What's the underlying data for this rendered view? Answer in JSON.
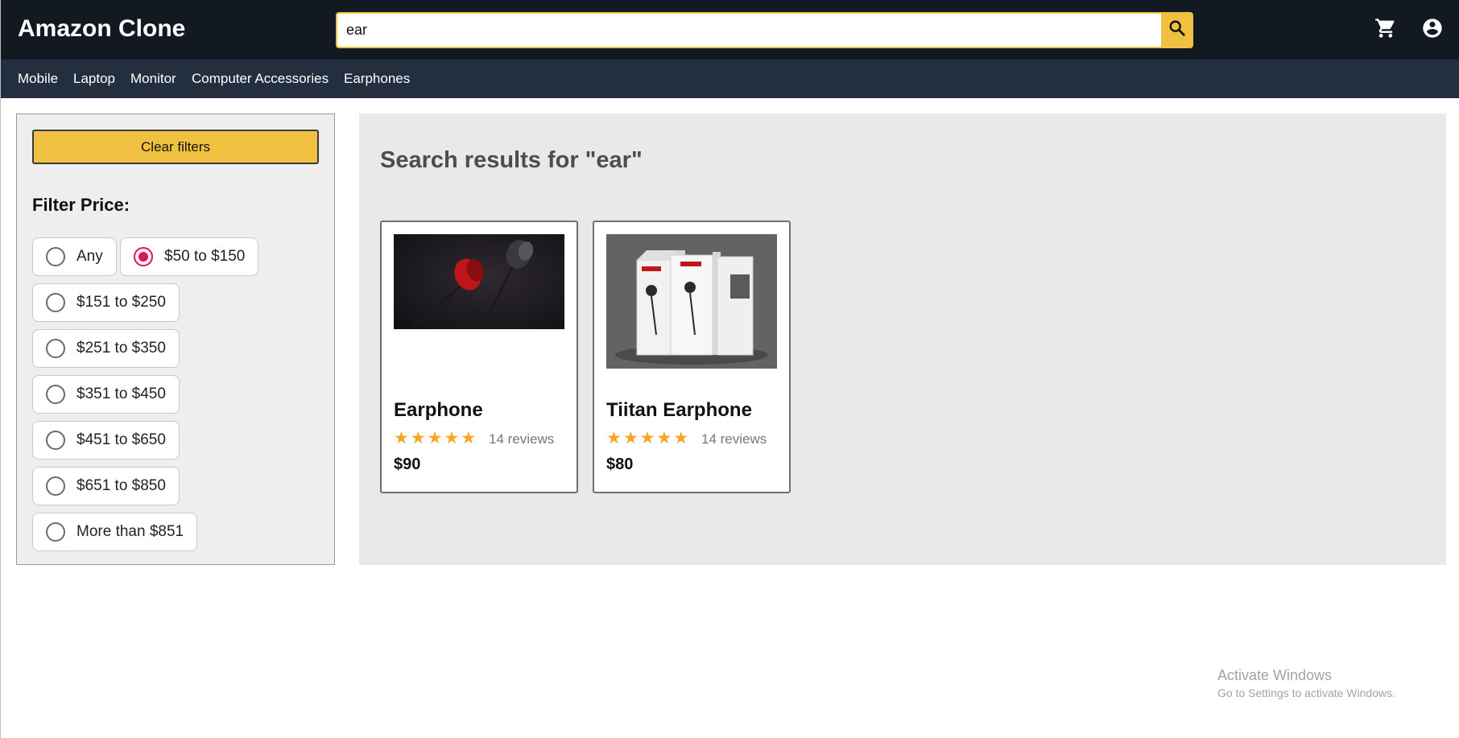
{
  "header": {
    "brand": "Amazon Clone",
    "search_value": "ear",
    "search_placeholder": "",
    "search_icon": "search-icon",
    "cart_icon": "cart-icon",
    "account_icon": "account-circle-icon"
  },
  "nav": {
    "items": [
      "Mobile",
      "Laptop",
      "Monitor",
      "Computer Accessories",
      "Earphones"
    ]
  },
  "filters": {
    "clear_label": "Clear filters",
    "price_title": "Filter Price:",
    "options": [
      {
        "label": "Any",
        "checked": false
      },
      {
        "label": "$50 to $150",
        "checked": true
      },
      {
        "label": "$151 to $250",
        "checked": false
      },
      {
        "label": "$251 to $350",
        "checked": false
      },
      {
        "label": "$351 to $450",
        "checked": false
      },
      {
        "label": "$451 to $650",
        "checked": false
      },
      {
        "label": "$651 to $850",
        "checked": false
      },
      {
        "label": "More than $851",
        "checked": false
      }
    ]
  },
  "results": {
    "title": "Search results for \"ear\"",
    "products": [
      {
        "name": "Earphone",
        "rating": 5,
        "reviews": "14 reviews",
        "price": "$90"
      },
      {
        "name": "Tiitan Earphone",
        "rating": 5,
        "reviews": "14 reviews",
        "price": "$80"
      }
    ]
  },
  "os_watermark": {
    "line1": "Activate Windows",
    "line2": "Go to Settings to activate Windows."
  },
  "colors": {
    "header_bg": "#131921",
    "nav_bg": "#232f3e",
    "accent": "#f0c040",
    "radio_checked": "#e0115f",
    "star": "#f5a623"
  }
}
